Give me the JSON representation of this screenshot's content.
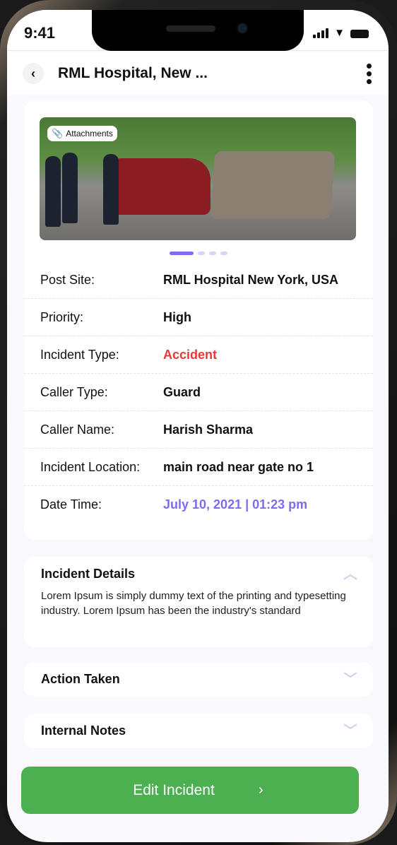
{
  "status_bar": {
    "time": "9:41"
  },
  "header": {
    "title": "RML Hospital, New ..."
  },
  "attachments_label": "Attachments",
  "carousel": {
    "total": 4,
    "active": 0
  },
  "details": [
    {
      "label": "Post Site:",
      "value": "RML Hospital New York, USA"
    },
    {
      "label": "Priority:",
      "value": "High"
    },
    {
      "label": "Incident Type:",
      "value": "Accident",
      "color": "#e53935"
    },
    {
      "label": "Caller Type:",
      "value": "Guard"
    },
    {
      "label": "Caller Name:",
      "value": "Harish Sharma"
    },
    {
      "label": "Incident Location:",
      "value": "main road near gate no 1"
    },
    {
      "label": "Date Time:",
      "value": "July 10, 2021 | 01:23 pm",
      "color": "#7b6cf0"
    }
  ],
  "sections": {
    "incident_details": {
      "title": "Incident Details",
      "body": "Lorem Ipsum is simply dummy text of the printing and typesetting industry. Lorem Ipsum has been the industry's standard"
    },
    "action_taken": {
      "title": "Action Taken"
    },
    "internal_notes": {
      "title": "Internal Notes"
    }
  },
  "edit_button": "Edit Incident",
  "colors": {
    "accent": "#7b6cf0",
    "primary_button": "#4caf50",
    "danger": "#e53935"
  }
}
